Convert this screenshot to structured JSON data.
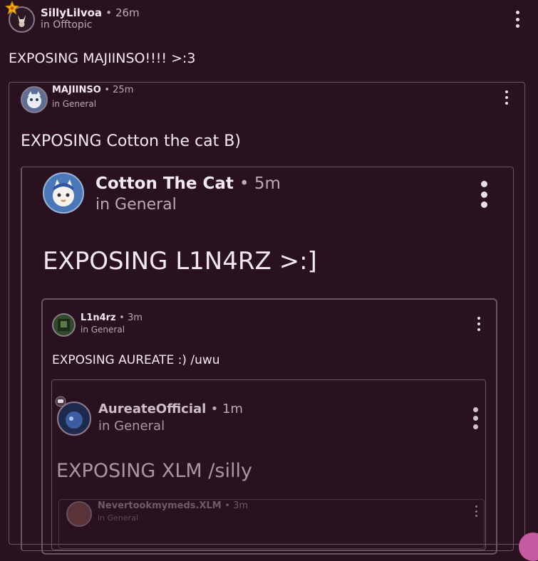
{
  "post1": {
    "user": "SillyLilvoa",
    "time": "26m",
    "community": "in Offtopic",
    "text": "EXPOSING MAJIINSO!!!! >:3"
  },
  "post2": {
    "user": "MAJIINSO",
    "time": "25m",
    "community": "in General",
    "text": "EXPOSING Cotton the cat B)"
  },
  "post3": {
    "user": "Cotton The Cat",
    "time": "5m",
    "community": "in General",
    "text": "EXPOSING L1N4RZ >:]"
  },
  "post4": {
    "user": "L1n4rz",
    "time": "3m",
    "community": "in General",
    "text": "EXPOSING AUREATE :) /uwu"
  },
  "post5": {
    "user": "AureateOfficial",
    "time": "1m",
    "community": "in General",
    "text": "EXPOSING XLM /silly"
  },
  "post6": {
    "user": "Nevertookmymeds.XLM",
    "time": "3m",
    "community": "in General"
  },
  "separator": "•",
  "colors": {
    "background": "#2a1120",
    "border": "#6d5464",
    "muted": "#b9a9b5",
    "badge": "#f0b400",
    "fab": "#c45aa0"
  },
  "icons": {
    "more": "kebab-menu-icon",
    "badge": "star-badge-icon"
  }
}
